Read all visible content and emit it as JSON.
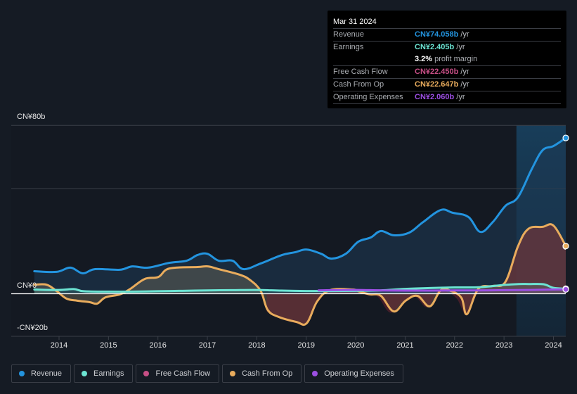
{
  "tooltip": {
    "date": "Mar 31 2024",
    "rows": [
      {
        "label": "Revenue",
        "value": "CN¥74.058b",
        "unit": "/yr",
        "color": "#2394df"
      },
      {
        "label": "Earnings",
        "value": "CN¥2.405b",
        "unit": "/yr",
        "color": "#6ce4d3"
      },
      {
        "label": "",
        "margin_pct": "3.2%",
        "margin_text": "profit margin"
      },
      {
        "label": "Free Cash Flow",
        "value": "CN¥22.450b",
        "unit": "/yr",
        "color": "#c74f86"
      },
      {
        "label": "Cash From Op",
        "value": "CN¥22.647b",
        "unit": "/yr",
        "color": "#e9ac5d"
      },
      {
        "label": "Operating Expenses",
        "value": "CN¥2.060b",
        "unit": "/yr",
        "color": "#9c4fe3"
      }
    ]
  },
  "legend": [
    {
      "label": "Revenue",
      "color": "#2394df"
    },
    {
      "label": "Earnings",
      "color": "#6ce4d3"
    },
    {
      "label": "Free Cash Flow",
      "color": "#c74f86"
    },
    {
      "label": "Cash From Op",
      "color": "#e9ac5d"
    },
    {
      "label": "Operating Expenses",
      "color": "#9c4fe3"
    }
  ],
  "chart_data": {
    "type": "area",
    "title": "",
    "xlabel": "",
    "ylabel": "",
    "ylim": [
      -20,
      80
    ],
    "xlim": [
      2013.5,
      2024.25
    ],
    "y_tick_labels": [
      {
        "value": 80,
        "label": "CN¥80b"
      },
      {
        "value": 0,
        "label": "CN¥0"
      },
      {
        "value": -20,
        "label": "-CN¥20b"
      }
    ],
    "x_tick_labels": [
      "2014",
      "2015",
      "2016",
      "2017",
      "2018",
      "2019",
      "2020",
      "2021",
      "2022",
      "2023",
      "2024"
    ],
    "x_ticks": [
      2014,
      2015,
      2016,
      2017,
      2018,
      2019,
      2020,
      2021,
      2022,
      2023,
      2024
    ],
    "highlight_start": 2023.25,
    "grid": true,
    "legend_position": "bottom",
    "series": [
      {
        "name": "Revenue",
        "color": "#2394df",
        "x": [
          2013.5,
          2013.95,
          2014.23,
          2014.48,
          2014.73,
          2015.23,
          2015.48,
          2015.8,
          2016.23,
          2016.58,
          2016.8,
          2017.0,
          2017.23,
          2017.51,
          2017.73,
          2018.08,
          2018.51,
          2018.77,
          2019.01,
          2019.3,
          2019.51,
          2019.8,
          2020.05,
          2020.3,
          2020.51,
          2020.77,
          2021.08,
          2021.36,
          2021.72,
          2021.96,
          2022.28,
          2022.52,
          2022.77,
          2023.03,
          2023.28,
          2023.56,
          2023.78,
          2024.0,
          2024.25
        ],
        "values": [
          10.7,
          10.4,
          12.4,
          9.7,
          11.7,
          11.4,
          13,
          12.4,
          14.7,
          15.7,
          18.4,
          19,
          15.7,
          15.7,
          11.7,
          14.4,
          18.4,
          19.7,
          21,
          19,
          16.7,
          19,
          24.7,
          26.7,
          29.8,
          27.8,
          29,
          34,
          39.8,
          38.5,
          36.5,
          29.4,
          34,
          41.8,
          45.8,
          59.2,
          68.2,
          70.2,
          74.06
        ]
      },
      {
        "name": "Earnings",
        "color": "#6ce4d3",
        "x": [
          2013.5,
          2014.0,
          2014.3,
          2014.5,
          2015.0,
          2015.5,
          2016.0,
          2016.5,
          2017.0,
          2017.5,
          2018.0,
          2018.5,
          2019.0,
          2019.5,
          2020.0,
          2020.5,
          2021.0,
          2021.5,
          2022.0,
          2022.5,
          2023.0,
          2023.3,
          2023.5,
          2023.8,
          2024.0,
          2024.25
        ],
        "values": [
          2.0,
          1.8,
          2.2,
          1.2,
          1.0,
          1.0,
          1.2,
          1.4,
          1.6,
          1.7,
          1.8,
          1.5,
          1.3,
          1.3,
          1.4,
          1.6,
          2.3,
          2.7,
          3.0,
          3.1,
          4.2,
          4.6,
          4.6,
          4.5,
          2.8,
          2.4
        ]
      },
      {
        "name": "Free Cash Flow",
        "color": "#c74f86",
        "x": [
          2018.2,
          2018.5,
          2018.8,
          2019.0,
          2019.2,
          2019.45,
          2019.9,
          2020.05,
          2020.25,
          2020.45,
          2020.7,
          2020.95,
          2021.2,
          2021.45,
          2021.65,
          2021.85,
          2022.05,
          2022.25,
          2022.45,
          2022.75,
          2023.0,
          2023.25,
          2023.45,
          2023.75,
          2024.0,
          2024.25
        ],
        "values": [
          -8.5,
          -12,
          -14,
          -14.5,
          -4.5,
          1.0,
          1.3,
          0.5,
          -0.8,
          -1.5,
          -9,
          -3.8,
          -1.5,
          -6.5,
          1.2,
          0.8,
          -2.5,
          -10.2,
          1.8,
          3.2,
          5.2,
          22,
          30.3,
          31.3,
          32,
          22.45
        ]
      },
      {
        "name": "Cash From Op",
        "color": "#e9ac5d",
        "x": [
          2013.5,
          2013.75,
          2013.95,
          2014.15,
          2014.37,
          2014.62,
          2014.77,
          2014.94,
          2015.23,
          2015.44,
          2015.73,
          2016.01,
          2016.23,
          2016.8,
          2017.01,
          2017.23,
          2017.66,
          2017.87,
          2018.08,
          2018.22,
          2018.44,
          2018.8,
          2019.01,
          2019.22,
          2019.48,
          2019.94,
          2020.08,
          2020.29,
          2020.51,
          2020.77,
          2021.01,
          2021.25,
          2021.5,
          2021.72,
          2021.93,
          2022.14,
          2022.25,
          2022.48,
          2022.77,
          2023.03,
          2023.28,
          2023.49,
          2023.78,
          2024.0,
          2024.25
        ],
        "values": [
          4.3,
          4.3,
          1.3,
          -2.3,
          -3.3,
          -4,
          -4.7,
          -1.7,
          -0.3,
          2.3,
          7,
          8,
          12,
          12.7,
          13,
          11.7,
          9,
          6.4,
          1.3,
          -7.7,
          -11,
          -13.4,
          -14,
          -3.7,
          1.7,
          2,
          1,
          -0.3,
          -1,
          -8.4,
          -3.3,
          -1,
          -6,
          1.7,
          1.3,
          -2,
          -9.7,
          2.3,
          3.7,
          5.7,
          22.4,
          30.8,
          31.8,
          32.4,
          22.65
        ]
      },
      {
        "name": "Operating Expenses",
        "color": "#9c4fe3",
        "x": [
          2019.25,
          2019.5,
          2020.0,
          2020.5,
          2021.0,
          2021.5,
          2022.0,
          2022.5,
          2023.0,
          2023.5,
          2024.0,
          2024.25
        ],
        "values": [
          1.6,
          1.7,
          1.8,
          1.6,
          1.5,
          1.5,
          1.6,
          1.6,
          1.7,
          1.8,
          2.0,
          2.06
        ]
      }
    ]
  }
}
